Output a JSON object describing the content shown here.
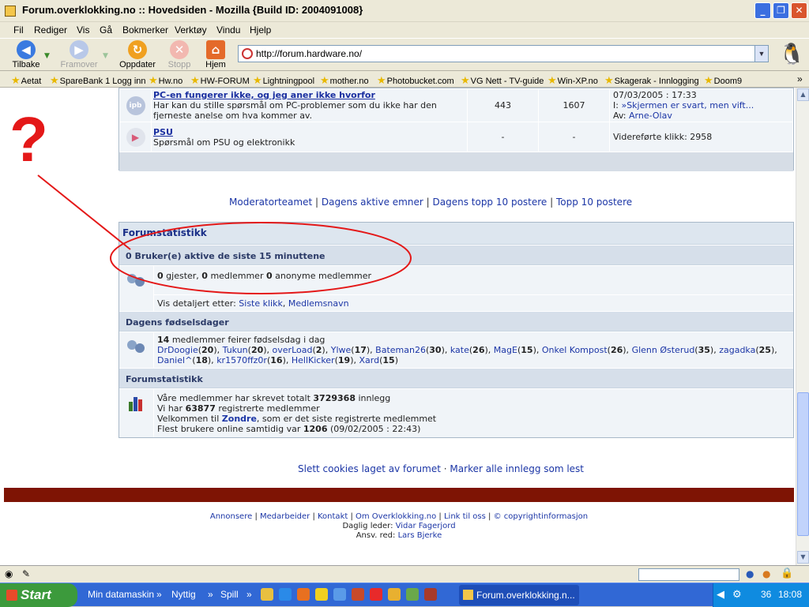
{
  "window": {
    "title": "Forum.overklokking.no :: Hovedsiden - Mozilla {Build ID: 2004091008}"
  },
  "menu": [
    "Fil",
    "Rediger",
    "Vis",
    "Gå",
    "Bokmerker",
    "Verktøy",
    "Vindu",
    "Hjelp"
  ],
  "nav": {
    "back": "Tilbake",
    "forward": "Framover",
    "reload": "Oppdater",
    "stop": "Stopp",
    "home": "Hjem"
  },
  "address": {
    "url": "http://forum.hardware.no/"
  },
  "bookmarks": [
    "Aetat",
    "SpareBank 1 Logg inn",
    "Hw.no",
    "HW-FORUM",
    "Lightningpool",
    "mother.no",
    "Photobucket.com",
    "VG Nett - TV-guide",
    "Win-XP.no",
    "Skagerak - Innlogging",
    "Doom9"
  ],
  "forums": [
    {
      "icon": "ipb",
      "title": "PC-en fungerer ikke, og jeg aner ikke hvorfor",
      "desc": "Har kan du stille spørsmål om PC-problemer som du ikke har den fjerneste anelse om hva kommer av.",
      "topics": "443",
      "posts": "1607",
      "last_date": "07/03/2005 : 17:33",
      "last_in_prefix": "I:",
      "last_in_topic": "Skjermen er svart, men vift...",
      "last_by_prefix": "Av:",
      "last_by": "Arne-Olav"
    },
    {
      "icon": "play",
      "title": "PSU",
      "desc": "Spørsmål om PSU og elektronikk",
      "topics": "-",
      "posts": "-",
      "last_text": "Videreførte klikk: 2958"
    }
  ],
  "navlinks": {
    "moderators": "Moderatorteamet",
    "active": "Dagens aktive emner",
    "top10today": "Dagens topp 10 postere",
    "top10": "Topp 10 postere",
    "sep": "|"
  },
  "stats": {
    "header": "Forumstatistikk",
    "active": {
      "title": "0 Bruker(e) aktive de siste 15 minuttene",
      "guests_count": "0",
      "guests_label": "gjester,",
      "members_count": "0",
      "members_label": "medlemmer",
      "anon_count": "0",
      "anon_label": "anonyme medlemmer",
      "sort_prefix": "Vis detaljert etter:",
      "sort_click": "Siste klikk",
      "sort_name": "Medlemsnavn"
    },
    "birthdays": {
      "title": "Dagens fødselsdager",
      "count": "14",
      "text": "medlemmer feirer fødselsdag i dag",
      "members": [
        {
          "name": "DrDoogie",
          "age": "20"
        },
        {
          "name": "Tukun",
          "age": "20"
        },
        {
          "name": "overLoad",
          "age": "2"
        },
        {
          "name": "Ylwe",
          "age": "17"
        },
        {
          "name": "Bateman26",
          "age": "30"
        },
        {
          "name": "kate",
          "age": "26"
        },
        {
          "name": "MagE",
          "age": "15"
        },
        {
          "name": "Onkel Kompost",
          "age": "26"
        },
        {
          "name": "Glenn Østerud",
          "age": "35"
        },
        {
          "name": "zagadka",
          "age": "25"
        },
        {
          "name": "Daniel^",
          "age": "18"
        },
        {
          "name": "kr1570ffz0r",
          "age": "16"
        },
        {
          "name": "HellKicker",
          "age": "19"
        },
        {
          "name": "Xard",
          "age": "15"
        }
      ]
    },
    "board": {
      "title": "Forumstatistikk",
      "l1_pre": "Våre medlemmer har skrevet totalt",
      "l1_num": "3729368",
      "l1_post": "innlegg",
      "l2_pre": "Vi har",
      "l2_num": "63877",
      "l2_post": "registrerte medlemmer",
      "l3_pre": "Velkommen til",
      "l3_name": "Zondre",
      "l3_post": ", som er det siste registrerte medlemmet",
      "l4_pre": "Flest brukere online samtidig var",
      "l4_num": "1206",
      "l4_post": "(09/02/2005 : 22:43)"
    }
  },
  "bottomlinks": {
    "cookies": "Slett cookies laget av forumet",
    "sep": "·",
    "mark": "Marker alle innlegg som lest"
  },
  "footer": {
    "links": [
      "Annonsere",
      "Medarbeider",
      "Kontakt",
      "Om Overklokking.no",
      "Link til oss",
      "© copyrightinformasjon"
    ],
    "leader_label": "Daglig leder:",
    "leader": "Vidar Fagerjord",
    "editor_label": "Ansv. red:",
    "editor": "Lars Bjerke"
  },
  "annotation": {
    "mark": "?"
  },
  "taskbar": {
    "start": "Start",
    "items": [
      "Min datamaskin",
      "Nyttig",
      "Spill"
    ],
    "more": "»",
    "window": "Forum.overklokking.n...",
    "tray_num": "36",
    "clock": "18:08"
  },
  "colors": {
    "link": "#1c36a6",
    "redbar": "#7e1404",
    "annotation": "#e41818",
    "taskbar": "#3168d5"
  }
}
